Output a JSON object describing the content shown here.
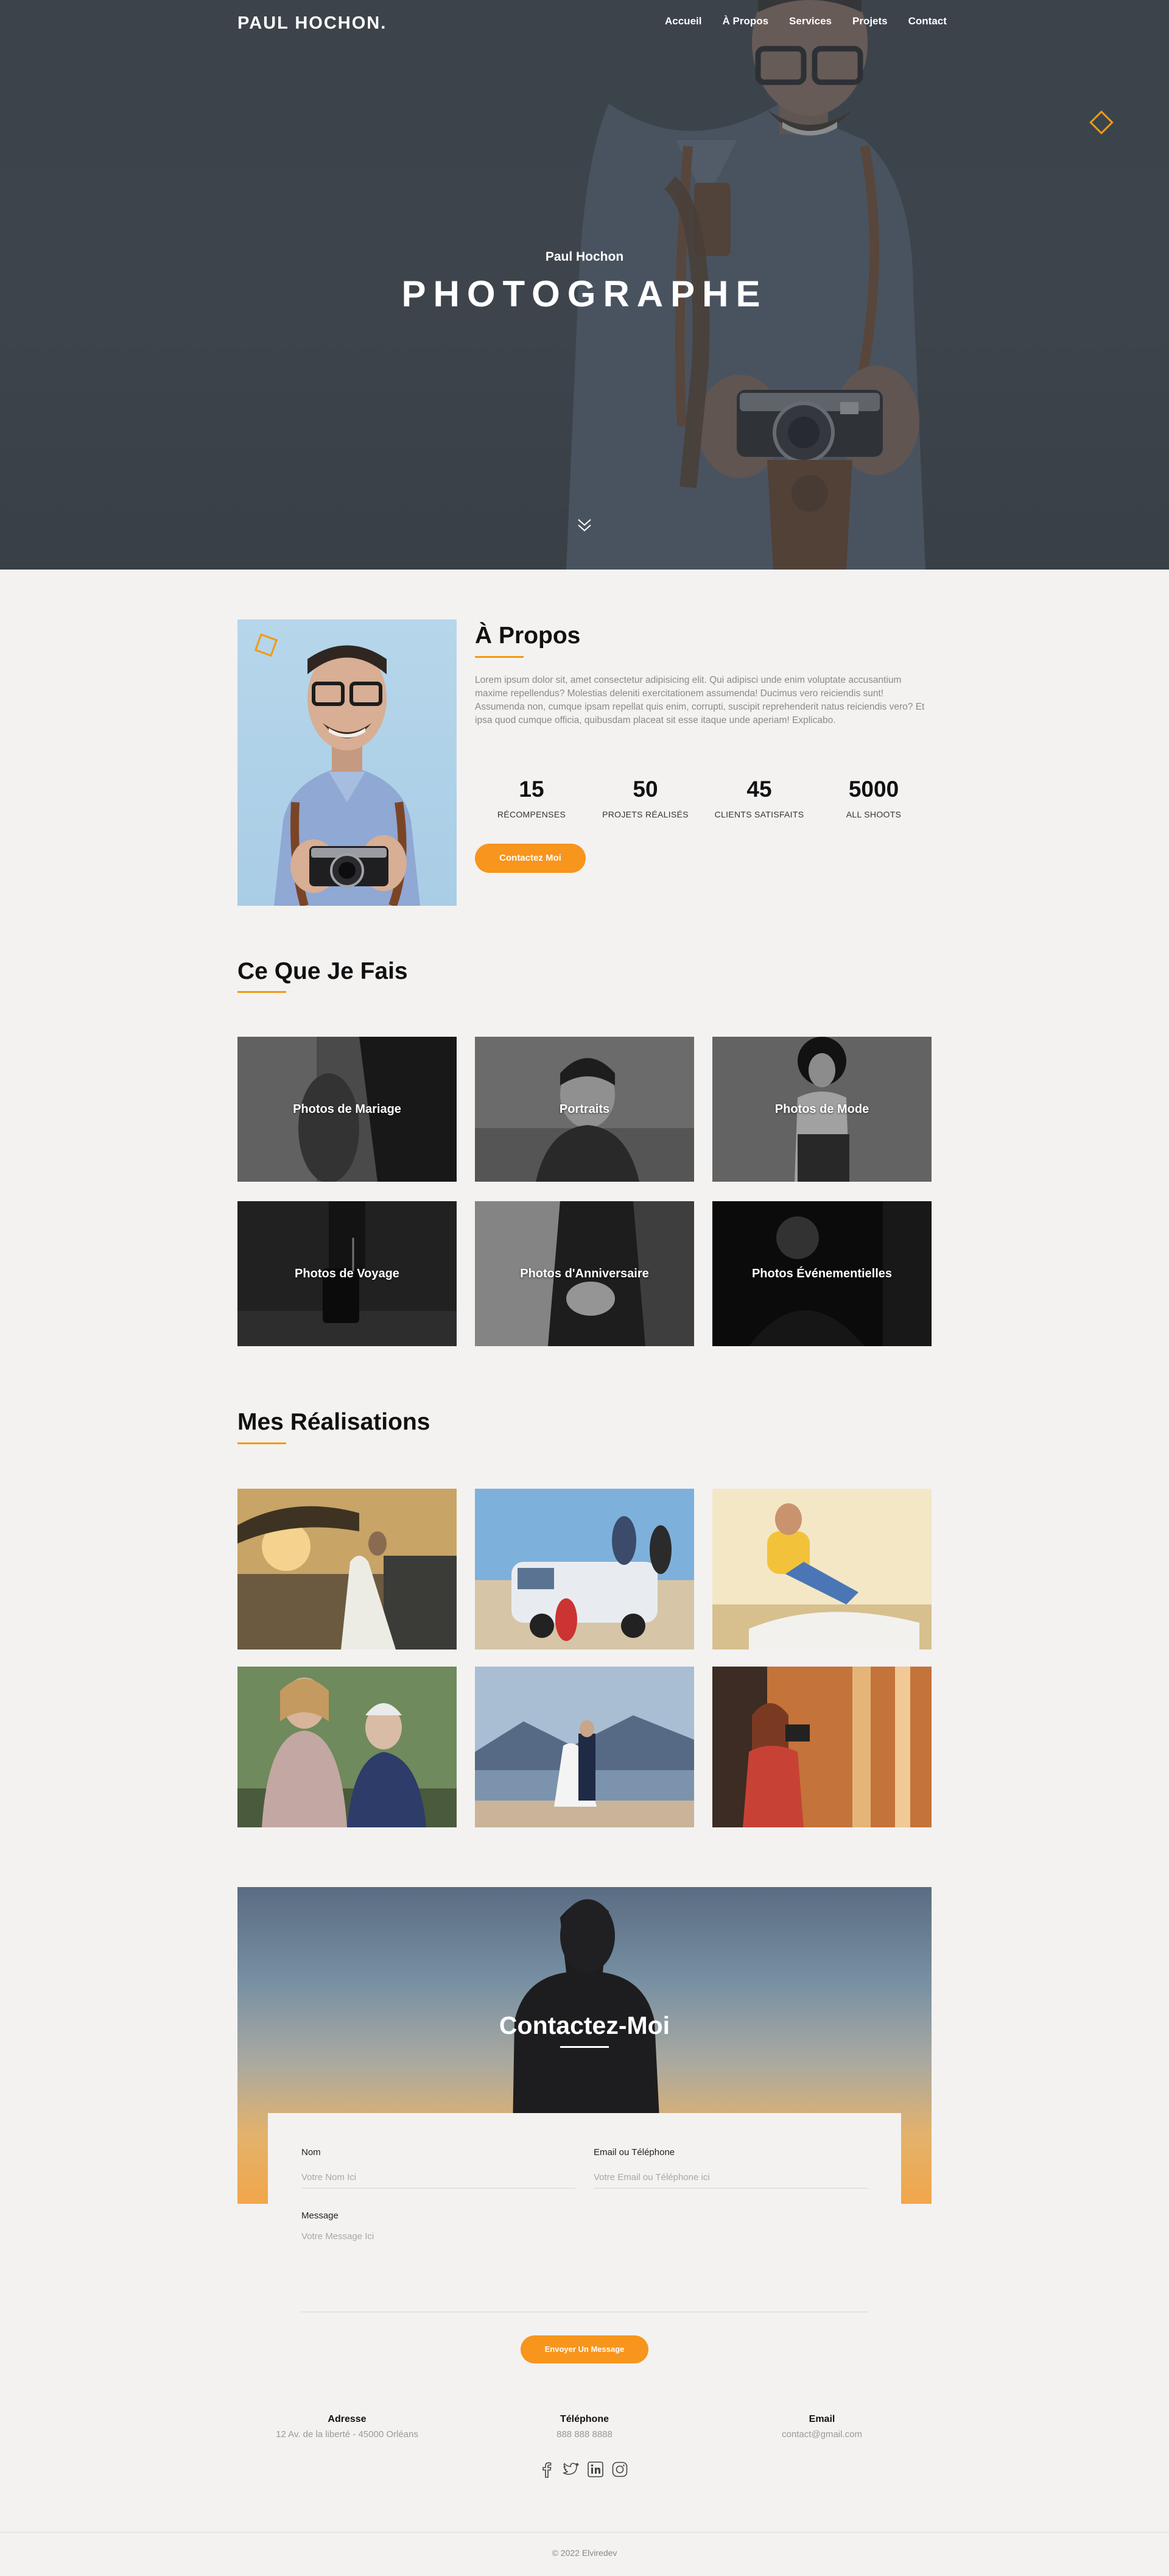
{
  "nav": {
    "logo": "PAUL HOCHON.",
    "links": [
      "Accueil",
      "À Propos",
      "Services",
      "Projets",
      "Contact"
    ]
  },
  "hero": {
    "subtitle": "Paul Hochon",
    "title": "PHOTOGRAPHE"
  },
  "about": {
    "title": "À Propos",
    "text": "Lorem ipsum dolor sit, amet consectetur adipisicing elit. Qui adipisci unde enim voluptate accusantium maxime repellendus? Molestias deleniti exercitationem assumenda! Ducimus vero reiciendis sunt! Assumenda non, cumque ipsam repellat quis enim, corrupti, suscipit reprehenderit natus reiciendis vero? Et ipsa quod cumque officia, quibusdam placeat sit esse itaque unde aperiam! Explicabo.",
    "stats": [
      {
        "value": "15",
        "label": "RÉCOMPENSES"
      },
      {
        "value": "50",
        "label": "PROJETS RÉALISÉS"
      },
      {
        "value": "45",
        "label": "CLIENTS SATISFAITS"
      },
      {
        "value": "5000",
        "label": "ALL SHOOTS"
      }
    ],
    "button": "Contactez Moi"
  },
  "services": {
    "title": "Ce Que Je Fais",
    "items": [
      "Photos de Mariage",
      "Portraits",
      "Photos de Mode",
      "Photos de Voyage",
      "Photos d'Anniversaire",
      "Photos Événementielles"
    ]
  },
  "portfolio": {
    "title": "Mes Réalisations"
  },
  "contact": {
    "title": "Contactez-Moi",
    "name_label": "Nom",
    "name_placeholder": "Votre Nom Ici",
    "email_label": "Email ou Téléphone",
    "email_placeholder": "Votre Email ou Téléphone ici",
    "message_label": "Message",
    "message_placeholder": "Votre Message Ici",
    "send_button": "Envoyer Un Message"
  },
  "info": {
    "address_label": "Adresse",
    "address_value": "12 Av. de la liberté - 45000 Orléans",
    "phone_label": "Téléphone",
    "phone_value": "888 888 8888",
    "email_label": "Email",
    "email_value": "contact@gmail.com"
  },
  "social_icons": [
    "facebook-icon",
    "twitter-icon",
    "linkedin-icon",
    "instagram-icon"
  ],
  "footer": {
    "copyright": "© 2022 Elviredev"
  },
  "colors": {
    "accent": "#f7951d",
    "background": "#f3f2f1",
    "hero_overlay": "#3f464d"
  }
}
